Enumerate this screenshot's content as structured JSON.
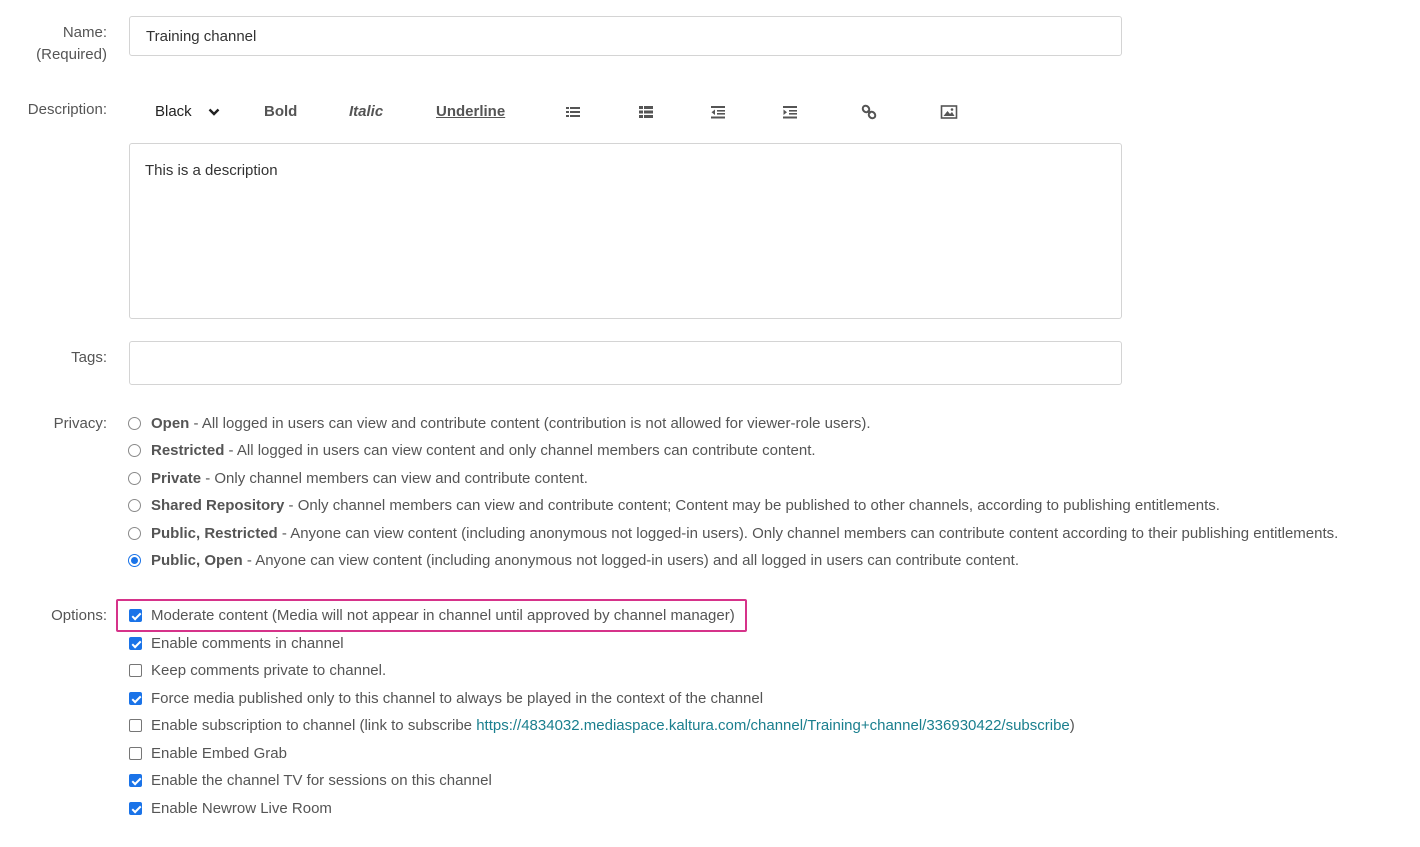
{
  "form": {
    "name_label": "Name:",
    "name_required": "(Required)",
    "name_value": "Training channel",
    "description_label": "Description:",
    "description_value": "This is a description",
    "tags_label": "Tags:",
    "tags_value": "",
    "privacy_label": "Privacy:",
    "options_label": "Options:"
  },
  "toolbar": {
    "color": "Black",
    "bold": "Bold",
    "italic": "Italic",
    "underline": "Underline",
    "icons": [
      "unordered-list-icon",
      "ordered-list-icon",
      "outdent-icon",
      "indent-icon",
      "link-icon",
      "image-icon"
    ]
  },
  "privacy": [
    {
      "title": "Open",
      "desc": " - All logged in users can view and contribute content (contribution is not allowed for viewer-role users).",
      "selected": false
    },
    {
      "title": "Restricted",
      "desc": " - All logged in users can view content and only channel members can contribute content.",
      "selected": false
    },
    {
      "title": "Private",
      "desc": " - Only channel members can view and contribute content.",
      "selected": false
    },
    {
      "title": "Shared Repository",
      "desc": " - Only channel members can view and contribute content; Content may be published to other channels, according to publishing entitlements.",
      "selected": false
    },
    {
      "title": "Public, Restricted",
      "desc": " - Anyone can view content (including anonymous not logged-in users). Only channel members can contribute content according to their publishing entitlements.",
      "selected": false
    },
    {
      "title": "Public, Open",
      "desc": " - Anyone can view content (including anonymous not logged-in users) and all logged in users can contribute content.",
      "selected": true
    }
  ],
  "options": [
    {
      "label": "Moderate content (Media will not appear in channel until approved by channel manager)",
      "checked": true
    },
    {
      "label": "Enable comments in channel",
      "checked": true
    },
    {
      "label": "Keep comments private to channel.",
      "checked": false
    },
    {
      "label": "Force media published only to this channel to always be played in the context of the channel",
      "checked": true
    },
    {
      "label": "Enable subscription to channel (link to subscribe ",
      "link": "https://4834032.mediaspace.kaltura.com/channel/Training+channel/336930422/subscribe",
      "suffix": ")",
      "checked": false
    },
    {
      "label": "Enable Embed Grab",
      "checked": false
    },
    {
      "label": "Enable the channel TV for sessions on this channel",
      "checked": true
    },
    {
      "label": "Enable Newrow Live Room",
      "checked": true
    }
  ],
  "colors": {
    "highlight": "#d6338a",
    "accent": "#1a73e8",
    "link": "#1a7f8e"
  }
}
